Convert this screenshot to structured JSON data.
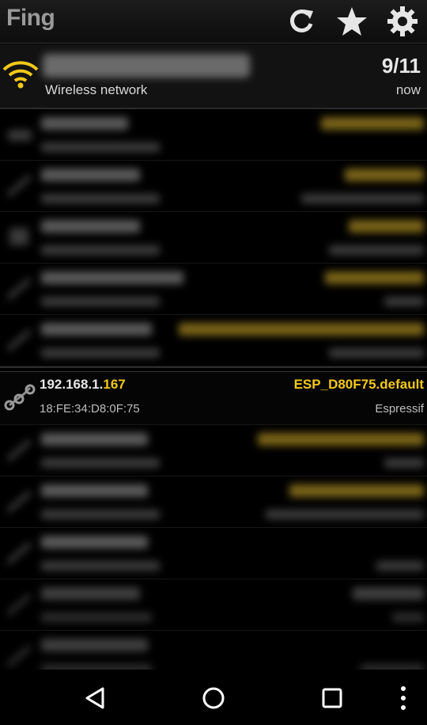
{
  "app": {
    "title": "Fing"
  },
  "toolbar": {
    "refresh_icon": "refresh-icon",
    "favorites_icon": "star-icon",
    "settings_icon": "gear-icon"
  },
  "network": {
    "type_label": "Wireless network",
    "host_count": "9/11",
    "last_scan": "now"
  },
  "selected_device": {
    "ip_prefix": "192.168.1.",
    "ip_suffix": "167",
    "mac": "18:FE:34:D8:0F:75",
    "name": "ESP_D80F75.default",
    "vendor": "Espressif"
  },
  "colors": {
    "accent": "#f2c81a",
    "background": "#000000",
    "header": "#121212"
  },
  "navigation": {
    "back_icon": "back-icon",
    "home_icon": "home-icon",
    "recents_icon": "recents-icon",
    "menu_icon": "overflow-menu-icon"
  }
}
